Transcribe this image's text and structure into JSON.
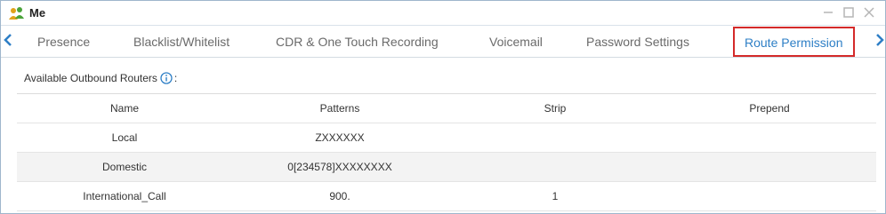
{
  "window": {
    "title": "Me",
    "icons": {
      "app": "users-icon",
      "minimize": "minimize-icon",
      "maximize": "maximize-icon",
      "close": "close-icon"
    }
  },
  "tabs": {
    "items": [
      {
        "label": "Presence",
        "active": false
      },
      {
        "label": "Blacklist/Whitelist",
        "active": false
      },
      {
        "label": "CDR & One Touch Recording",
        "active": false
      },
      {
        "label": "Voicemail",
        "active": false
      },
      {
        "label": "Password Settings",
        "active": false
      },
      {
        "label": "Route Permission",
        "active": true
      }
    ],
    "icons": {
      "prev": "chevron-left-icon",
      "next": "chevron-right-icon"
    }
  },
  "section": {
    "label": "Available Outbound Routers",
    "suffix": ":",
    "info_icon": "info-icon"
  },
  "table": {
    "columns": [
      "Name",
      "Patterns",
      "Strip",
      "Prepend"
    ],
    "rows": [
      {
        "name": "Local",
        "patterns": "ZXXXXXX",
        "strip": "",
        "prepend": ""
      },
      {
        "name": "Domestic",
        "patterns": "0[234578]XXXXXXXX",
        "strip": "",
        "prepend": ""
      },
      {
        "name": "International_Call",
        "patterns": "900.",
        "strip": "1",
        "prepend": ""
      }
    ]
  },
  "colors": {
    "accent": "#2e7fc6",
    "active_tab_border": "#d42a2a",
    "tab_text": "#6a6a6a",
    "alt_row": "#f3f3f3"
  }
}
